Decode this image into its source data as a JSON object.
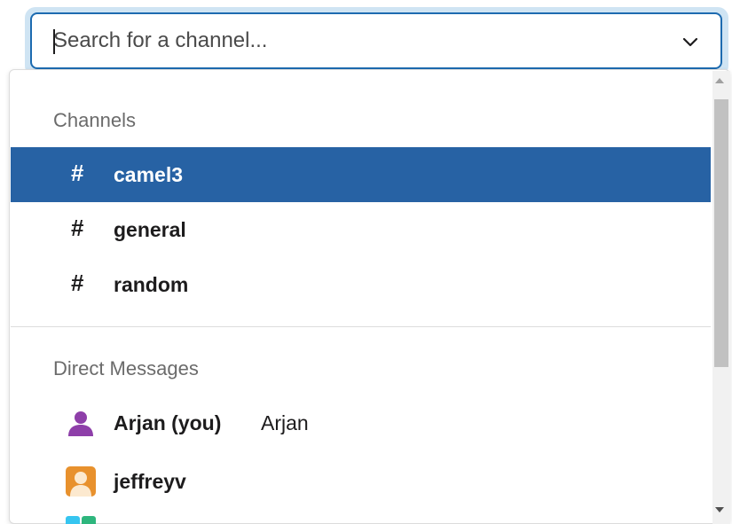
{
  "search": {
    "placeholder": "Search for a channel...",
    "value": ""
  },
  "channels": {
    "header": "Channels",
    "items": [
      {
        "name": "camel3",
        "selected": true
      },
      {
        "name": "general",
        "selected": false
      },
      {
        "name": "random",
        "selected": false
      }
    ]
  },
  "direct_messages": {
    "header": "Direct Messages",
    "items": [
      {
        "name": "Arjan (you)",
        "secondary": "Arjan",
        "avatar": "person-icon-purple"
      },
      {
        "name": "jeffreyv",
        "secondary": "",
        "avatar": "person-avatar-orange"
      }
    ]
  },
  "colors": {
    "selected_bg": "#2762a4",
    "focus_border": "#1d6bb0",
    "focus_ring": "#cfe4f3",
    "avatar_purple": "#8e3fa9",
    "avatar_orange": "#e8912d"
  },
  "icons": {
    "hash": "#",
    "chevron": "chevron-down-icon"
  }
}
